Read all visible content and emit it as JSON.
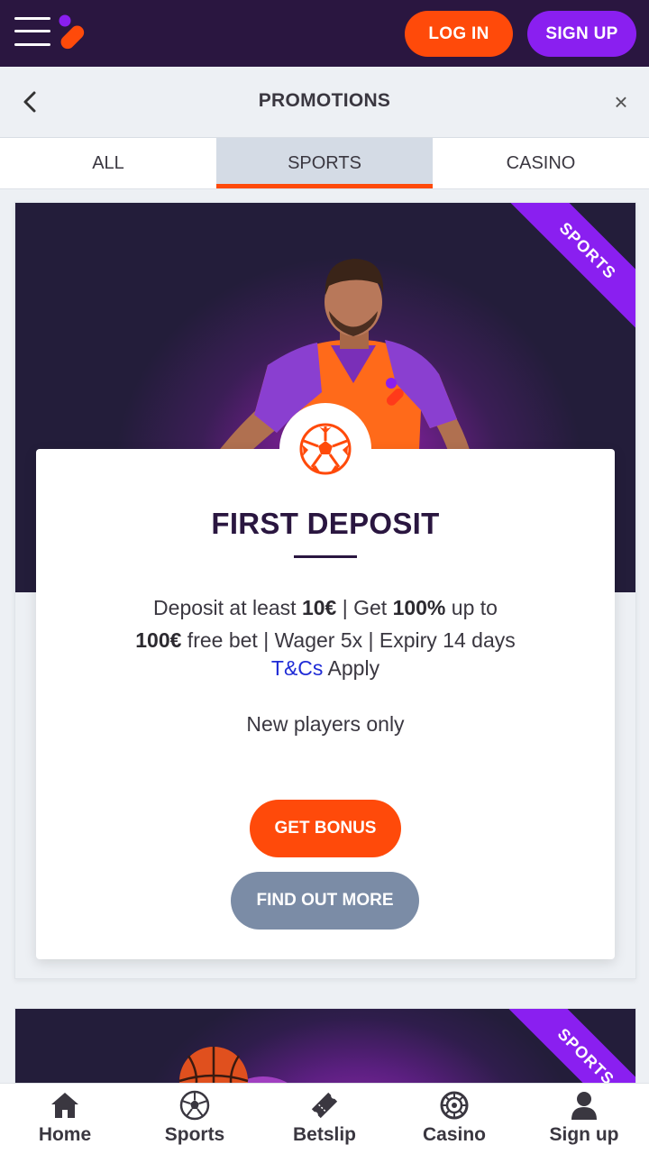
{
  "topbar": {
    "menu_icon": "hamburger-menu-icon",
    "logo_icon": "brand-logo-icon",
    "login_label": "LOG IN",
    "signup_label": "SIGN UP",
    "colors": {
      "bg": "#2a1640",
      "login": "#ff4a0a",
      "signup": "#8a1ff0"
    }
  },
  "header": {
    "title": "PROMOTIONS",
    "back_icon": "chevron-left-icon",
    "close_icon": "close-icon",
    "close_glyph": "×"
  },
  "tabs": [
    {
      "label": "ALL",
      "active": false
    },
    {
      "label": "SPORTS",
      "active": true
    },
    {
      "label": "CASINO",
      "active": false
    }
  ],
  "promo": {
    "ribbon": "SPORTS",
    "icon": "soccer-ball-icon",
    "title": "FIRST DEPOSIT",
    "desc_p1": "Deposit at least ",
    "desc_b1": "10€",
    "desc_p2": " | Get ",
    "desc_b2": "100%",
    "desc_p3": " up to ",
    "desc_b3": "100€",
    "desc_p4": " free bet | Wager 5x | Expiry 14 days",
    "tc_link": "T&Cs",
    "tc_rest": " Apply",
    "audience": "New players only",
    "get_bonus_label": "GET BONUS",
    "find_out_label": "FIND OUT MORE"
  },
  "promo2": {
    "ribbon": "SPORTS"
  },
  "bottom_nav": [
    {
      "label": "Home",
      "icon": "home-icon"
    },
    {
      "label": "Sports",
      "icon": "soccer-ball-icon"
    },
    {
      "label": "Betslip",
      "icon": "ticket-icon"
    },
    {
      "label": "Casino",
      "icon": "roulette-icon"
    },
    {
      "label": "Sign up",
      "icon": "user-icon"
    }
  ]
}
